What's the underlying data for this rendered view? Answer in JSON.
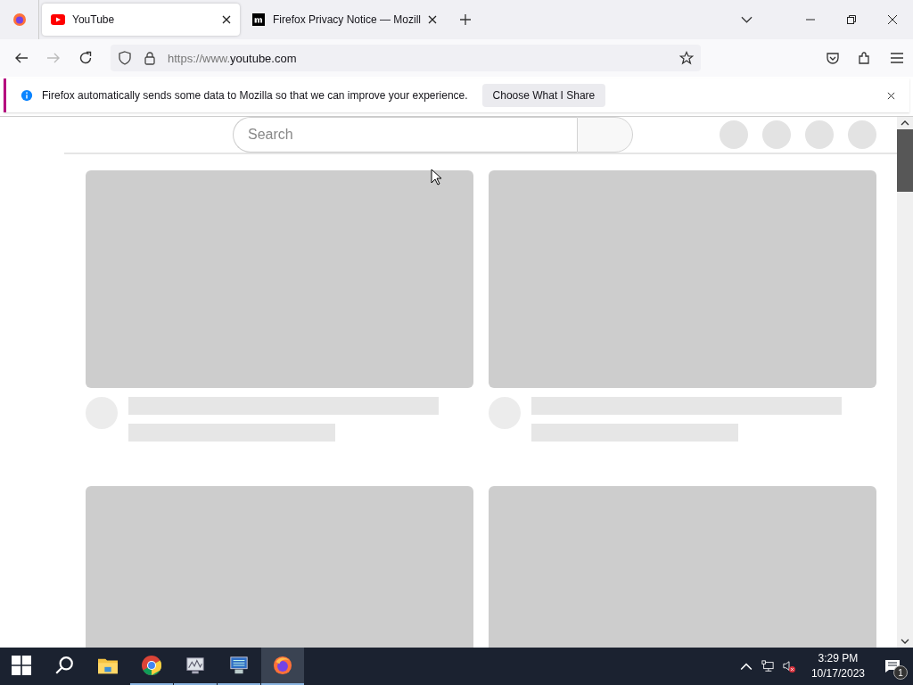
{
  "tabs": [
    {
      "title": "YouTube",
      "kind": "youtube",
      "selected": true
    },
    {
      "title": "Firefox Privacy Notice — Mozill",
      "kind": "mozilla",
      "selected": false
    }
  ],
  "nav": {
    "back_disabled": false,
    "forward_disabled": true
  },
  "address": {
    "prefix": "https://www.",
    "domain": "youtube.com"
  },
  "notification": {
    "message": "Firefox automatically sends some data to Mozilla so that we can improve your experience.",
    "button": "Choose What I Share"
  },
  "page": {
    "search": {
      "placeholder": "Search"
    }
  },
  "taskbar": {
    "apps": [
      {
        "kind": "explorer",
        "running": false,
        "selected": false
      },
      {
        "kind": "chrome",
        "running": true,
        "selected": false
      },
      {
        "kind": "monitor",
        "running": true,
        "selected": false
      },
      {
        "kind": "server",
        "running": true,
        "selected": false
      },
      {
        "kind": "firefox",
        "running": true,
        "selected": true
      }
    ],
    "time": "3:29 PM",
    "date": "10/17/2023",
    "notifications": "1"
  }
}
